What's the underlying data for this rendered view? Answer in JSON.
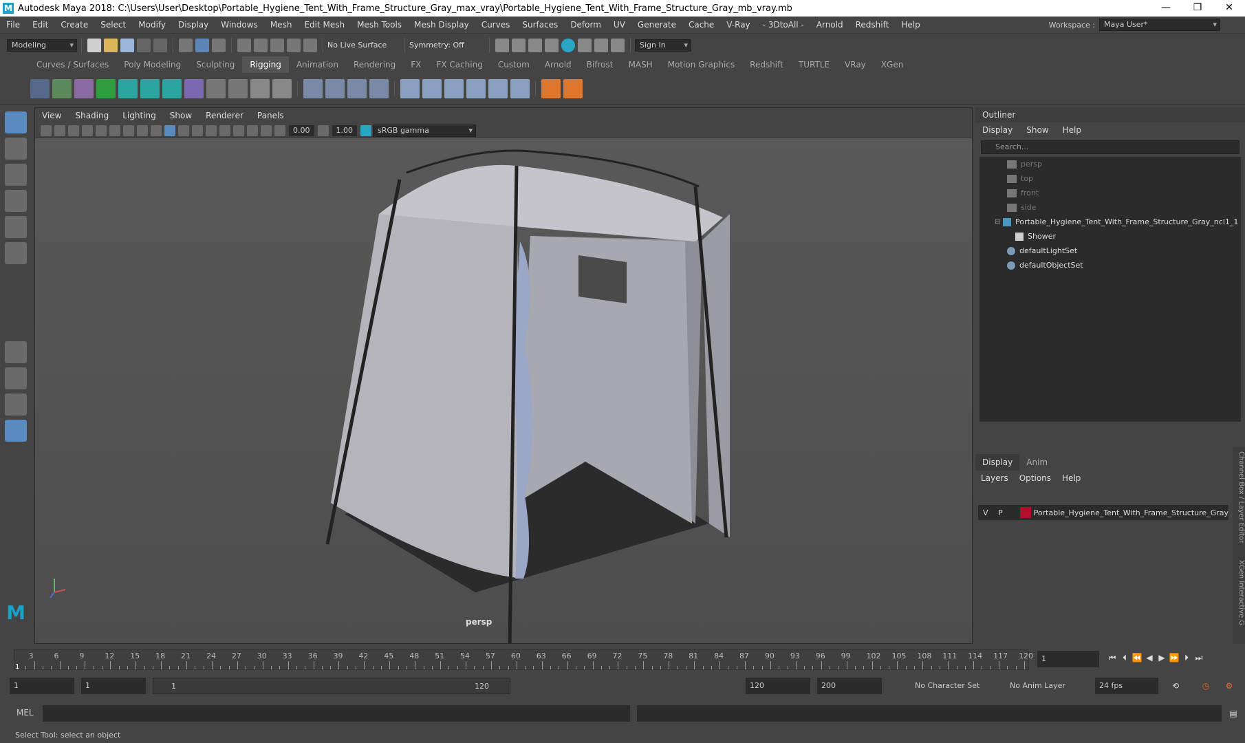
{
  "window": {
    "title": "Autodesk Maya 2018: C:\\Users\\User\\Desktop\\Portable_Hygiene_Tent_With_Frame_Structure_Gray_max_vray\\Portable_Hygiene_Tent_With_Frame_Structure_Gray_mb_vray.mb",
    "minimize": "—",
    "maximize": "❐",
    "close": "✕"
  },
  "menus": [
    "File",
    "Edit",
    "Create",
    "Select",
    "Modify",
    "Display",
    "Windows",
    "Mesh",
    "Edit Mesh",
    "Mesh Tools",
    "Mesh Display",
    "Curves",
    "Surfaces",
    "Deform",
    "UV",
    "Generate",
    "Cache",
    "V-Ray",
    "- 3DtoAll -",
    "Arnold",
    "Redshift",
    "Help"
  ],
  "workspace": {
    "label": "Workspace :",
    "value": "Maya User*"
  },
  "status": {
    "mode": "Modeling",
    "live_surface": "No Live Surface",
    "symmetry": "Symmetry: Off",
    "sign_in": "Sign In"
  },
  "shelf_tabs": [
    "Curves / Surfaces",
    "Poly Modeling",
    "Sculpting",
    "Rigging",
    "Animation",
    "Rendering",
    "FX",
    "FX Caching",
    "Custom",
    "Arnold",
    "Bifrost",
    "MASH",
    "Motion Graphics",
    "Redshift",
    "TURTLE",
    "VRay",
    "XGen"
  ],
  "shelf_active": "Rigging",
  "viewport": {
    "menus": [
      "View",
      "Shading",
      "Lighting",
      "Show",
      "Renderer",
      "Panels"
    ],
    "exposure": "0.00",
    "gamma": "1.00",
    "colorspace": "sRGB gamma",
    "camera_label": "persp"
  },
  "outliner": {
    "title": "Outliner",
    "menus": [
      "Display",
      "Show",
      "Help"
    ],
    "search_placeholder": "Search...",
    "items": [
      {
        "label": "persp",
        "dim": true,
        "indent": 1,
        "icon": "camera-icon"
      },
      {
        "label": "top",
        "dim": true,
        "indent": 1,
        "icon": "camera-icon"
      },
      {
        "label": "front",
        "dim": true,
        "indent": 1,
        "icon": "camera-icon"
      },
      {
        "label": "side",
        "dim": true,
        "indent": 1,
        "icon": "camera-icon"
      },
      {
        "label": "Portable_Hygiene_Tent_With_Frame_Structure_Gray_ncl1_1",
        "dim": false,
        "indent": 1,
        "icon": "group-icon"
      },
      {
        "label": "Shower",
        "dim": false,
        "indent": 2,
        "icon": "mesh-icon"
      },
      {
        "label": "defaultLightSet",
        "dim": false,
        "indent": 1,
        "icon": "set-icon"
      },
      {
        "label": "defaultObjectSet",
        "dim": false,
        "indent": 1,
        "icon": "set-icon"
      }
    ]
  },
  "layer_editor": {
    "tabs": [
      "Display",
      "Anim"
    ],
    "menus": [
      "Layers",
      "Options",
      "Help"
    ],
    "layer": {
      "v": "V",
      "p": "P",
      "name": "Portable_Hygiene_Tent_With_Frame_Structure_Gray",
      "color": "#b0102a"
    },
    "side_label": "Channel Box / Layer Editor",
    "side_label2": "XGen Interactive G"
  },
  "timeline": {
    "ticks": [
      "3",
      "6",
      "9",
      "12",
      "15",
      "18",
      "21",
      "24",
      "27",
      "30",
      "33",
      "36",
      "39",
      "42",
      "45",
      "48",
      "51",
      "54",
      "57",
      "60",
      "63",
      "66",
      "69",
      "72",
      "75",
      "78",
      "81",
      "84",
      "87",
      "90",
      "93",
      "96",
      "99",
      "102",
      "105",
      "108",
      "111",
      "114",
      "117",
      "120"
    ],
    "current_frame": "1",
    "current_marker": "1"
  },
  "range": {
    "start": "1",
    "start2": "1",
    "slider_start": "1",
    "slider_end": "120",
    "end": "120",
    "end2": "200",
    "character_set": "No Character Set",
    "anim_layer": "No Anim Layer",
    "fps": "24 fps"
  },
  "cmd": {
    "label": "MEL"
  },
  "statusbar": {
    "text": "Select Tool: select an object"
  }
}
